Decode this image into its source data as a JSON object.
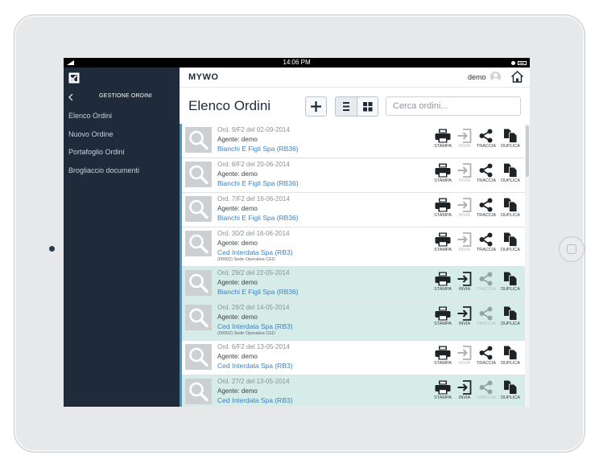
{
  "statusbar": {
    "time": "14:06 PM"
  },
  "sidebar": {
    "title": "GESTIONE ORDINI",
    "items": [
      {
        "label": "Elenco Ordini"
      },
      {
        "label": "Nuovo Ordine"
      },
      {
        "label": "Portafoglio Ordini"
      },
      {
        "label": "Brogliaccio documenti"
      }
    ]
  },
  "header": {
    "app_name": "MYWO",
    "user": "demo"
  },
  "page": {
    "title": "Elenco Ordini",
    "search_placeholder": "Cerca ordini..."
  },
  "actions": {
    "stampa": "STAMPA",
    "invia": "INVIA",
    "traccia": "TRACCIA",
    "duplica": "DUPLICA"
  },
  "orders": [
    {
      "title": "Ord. 9/F2 del 02-09-2014",
      "agent": "Agente: demo",
      "client": "Bianchi E Figli Spa (RB36)",
      "sub": "",
      "highlight": false,
      "invia_enabled": false,
      "traccia_enabled": true
    },
    {
      "title": "Ord. 8/F2 del 20-06-2014",
      "agent": "Agente: demo",
      "client": "Bianchi E Figli Spa (RB36)",
      "sub": "",
      "highlight": false,
      "invia_enabled": false,
      "traccia_enabled": true
    },
    {
      "title": "Ord. 7/F2 del 16-06-2014",
      "agent": "Agente: demo",
      "client": "Bianchi E Figli Spa (RB36)",
      "sub": "",
      "highlight": false,
      "invia_enabled": false,
      "traccia_enabled": true
    },
    {
      "title": "Ord. 30/2 del 16-06-2014",
      "agent": "Agente: demo",
      "client": "Ced Interdata Spa (RB3)",
      "sub": "(00002) Sede Operativa CED",
      "highlight": false,
      "invia_enabled": false,
      "traccia_enabled": true
    },
    {
      "title": "Ord. 29/2 del 22-05-2014",
      "agent": "Agente: demo",
      "client": "Bianchi E Figli Spa (RB36)",
      "sub": "",
      "highlight": true,
      "invia_enabled": true,
      "traccia_enabled": false
    },
    {
      "title": "Ord. 28/2 del 14-05-2014",
      "agent": "Agente: demo",
      "client": "Ced Interdata Spa (RB3)",
      "sub": "(00002) Sede Operativa CED",
      "highlight": true,
      "invia_enabled": true,
      "traccia_enabled": false
    },
    {
      "title": "Ord. 6/F2 del 13-05-2014",
      "agent": "Agente: demo",
      "client": "Ced Interdata Spa (RB3)",
      "sub": "",
      "highlight": false,
      "invia_enabled": false,
      "traccia_enabled": true
    },
    {
      "title": "Ord. 27/2 del 13-05-2014",
      "agent": "Agente: demo",
      "client": "Ced Interdata Spa (RB3)",
      "sub": "",
      "highlight": true,
      "invia_enabled": true,
      "traccia_enabled": false
    }
  ]
}
